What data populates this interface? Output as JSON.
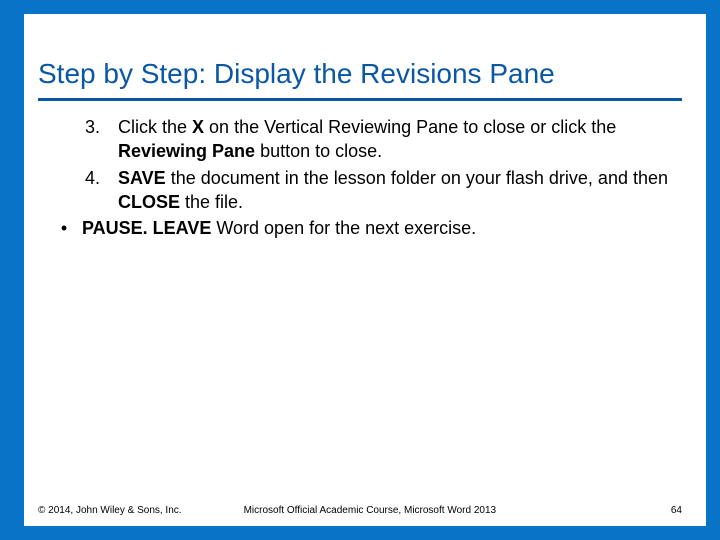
{
  "title": "Step by Step: Display the Revisions Pane",
  "steps": [
    {
      "num": "3.",
      "html": "Click the <b>X</b> on the Vertical Reviewing Pane to close or click the <b>Reviewing Pane</b> button to close."
    },
    {
      "num": "4.",
      "html": " <b>SAVE</b> the document in the lesson folder on your flash drive, and then <b>CLOSE</b> the file."
    }
  ],
  "bullets": [
    {
      "html": "<b>PAUSE. LEAVE</b> Word open for the next exercise."
    }
  ],
  "footer": {
    "copyright": "© 2014, John Wiley & Sons, Inc.",
    "course": "Microsoft Official Academic Course, Microsoft Word 2013",
    "page": "64"
  }
}
